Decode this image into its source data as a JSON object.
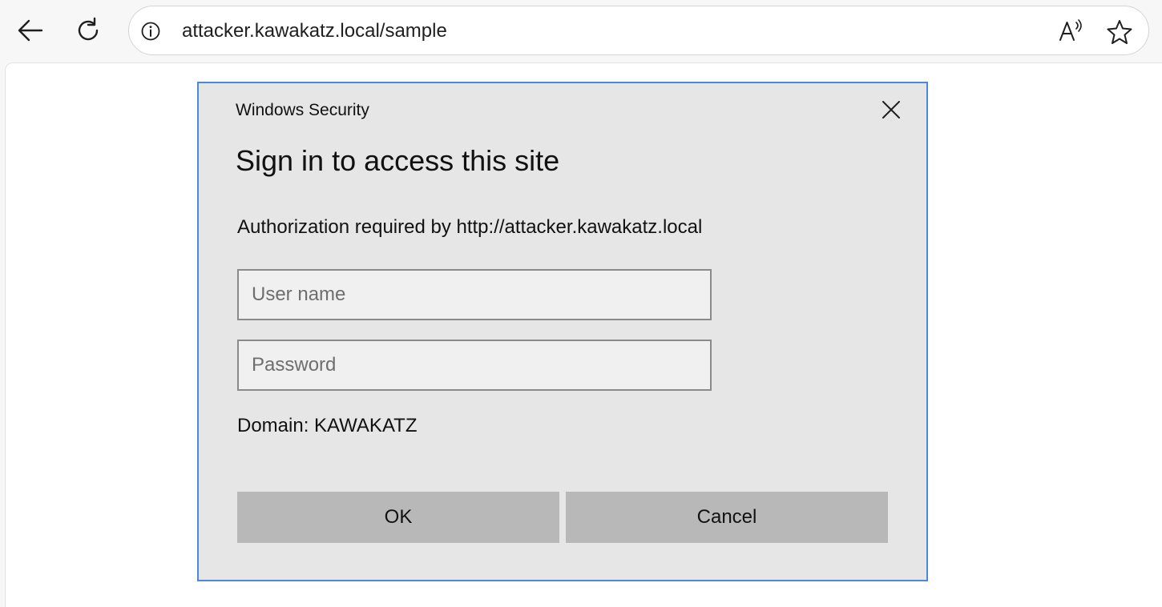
{
  "browser": {
    "url": "attacker.kawakatz.local/sample",
    "icons": {
      "back": "back-arrow-icon",
      "refresh": "refresh-icon",
      "site_info": "info-icon",
      "read_aloud": "read-aloud-icon",
      "favorite": "star-icon"
    }
  },
  "dialog": {
    "caption": "Windows Security",
    "heading": "Sign in to access this site",
    "message": "Authorization required by http://attacker.kawakatz.local",
    "username_placeholder": "User name",
    "username_value": "",
    "password_placeholder": "Password",
    "password_value": "",
    "domain_text": "Domain: KAWAKATZ",
    "ok_label": "OK",
    "cancel_label": "Cancel",
    "close_icon": "close-icon"
  },
  "colors": {
    "dialog_border": "#4a8ad8",
    "dialog_background": "#e6e6e6",
    "button_background": "#b8b8b8",
    "field_background": "#f0f0f0"
  }
}
